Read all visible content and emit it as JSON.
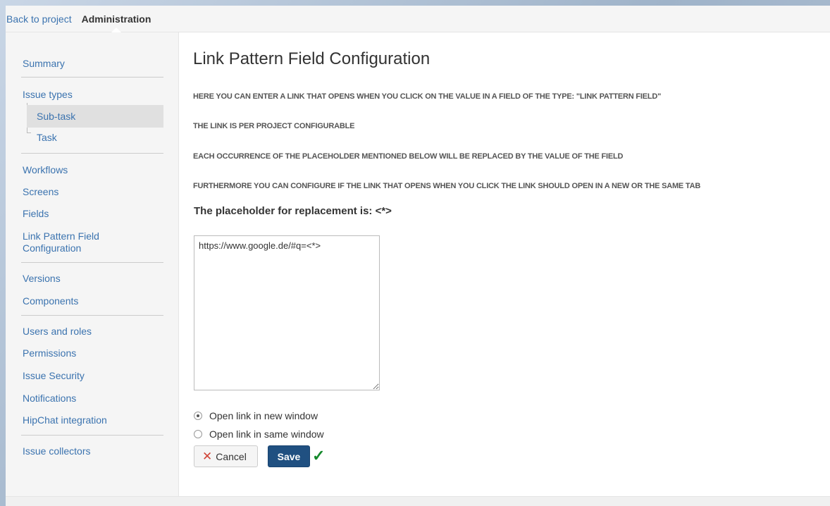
{
  "topbar": {
    "back_label": "Back to project",
    "admin_label": "Administration"
  },
  "sidebar": {
    "summary": "Summary",
    "issue_types": "Issue types",
    "sub_task": "Sub-task",
    "task": "Task",
    "workflows": "Workflows",
    "screens": "Screens",
    "fields": "Fields",
    "link_pattern": "Link Pattern Field Configuration",
    "versions": "Versions",
    "components": "Components",
    "users_roles": "Users and roles",
    "permissions": "Permissions",
    "issue_security": "Issue Security",
    "notifications": "Notifications",
    "hipchat": "HipChat integration",
    "issue_collectors": "Issue collectors"
  },
  "main": {
    "title": "Link Pattern Field Configuration",
    "desc1": "HERE YOU CAN ENTER A LINK THAT OPENS WHEN YOU CLICK ON THE VALUE IN A FIELD OF THE TYPE: \"LINK PATTERN FIELD\"",
    "desc2": "THE LINK IS PER PROJECT CONFIGURABLE",
    "desc3": "EACH OCCURRENCE OF THE PLACEHOLDER MENTIONED BELOW WILL BE REPLACED BY THE VALUE OF THE FIELD",
    "desc4": "FURTHERMORE YOU CAN CONFIGURE IF THE LINK THAT OPENS WHEN YOU CLICK THE LINK SHOULD OPEN IN A NEW OR THE SAME TAB",
    "placeholder_heading": "The placeholder for replacement is: <*>",
    "url_value": "https://www.google.de/#q=<*>",
    "radio_new": "Open link in new window",
    "radio_same": "Open link in same window",
    "selected_option": "Open link in new window",
    "cancel_label": "Cancel",
    "save_label": "Save",
    "saved_indicator": "✓"
  }
}
